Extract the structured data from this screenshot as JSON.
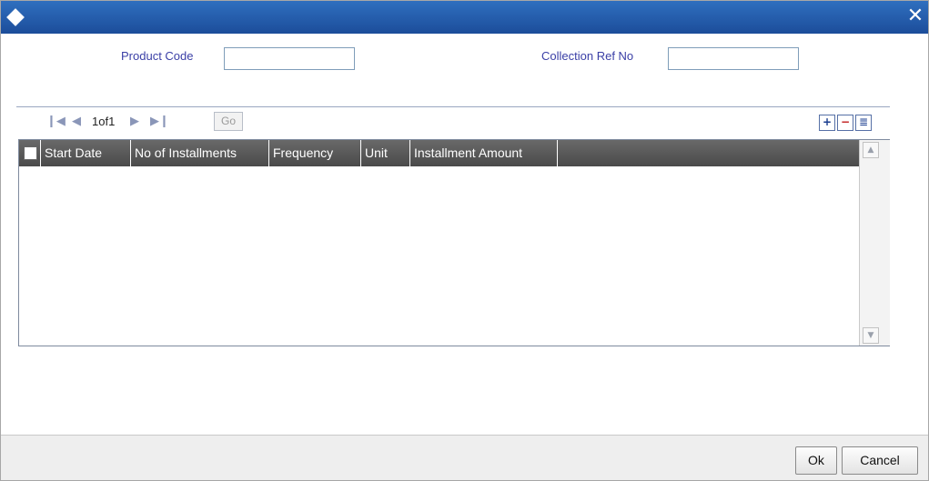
{
  "window": {
    "title_icon": "diamond-icon",
    "close_glyph": "✕"
  },
  "form": {
    "product_code_label": "Product Code",
    "product_code_value": "",
    "collection_ref_label": "Collection Ref No",
    "collection_ref_value": ""
  },
  "pager": {
    "first_glyph": "❙◀",
    "prev_glyph": "◀",
    "page_text": "1of1",
    "next_glyph": "▶",
    "last_glyph": "▶❙",
    "go_label": "Go"
  },
  "toolbar": {
    "add_glyph": "+",
    "remove_glyph": "−",
    "view_glyph": "≣"
  },
  "table": {
    "columns": [
      "Start Date",
      "No of Installments",
      "Frequency",
      "Unit",
      "Installment Amount"
    ],
    "rows": []
  },
  "scrollbar": {
    "up_glyph": "▲",
    "down_glyph": "▼"
  },
  "footer": {
    "ok_label": "Ok",
    "cancel_label": "Cancel"
  },
  "colors": {
    "titlebar": "#1c4d9a",
    "label": "#3a3fa6",
    "grid_header": "#5a5a5a"
  }
}
